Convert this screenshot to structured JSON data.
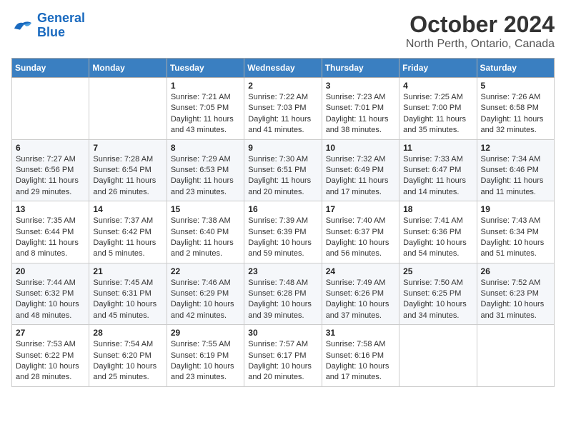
{
  "header": {
    "logo_line1": "General",
    "logo_line2": "Blue",
    "month_year": "October 2024",
    "location": "North Perth, Ontario, Canada"
  },
  "days_of_week": [
    "Sunday",
    "Monday",
    "Tuesday",
    "Wednesday",
    "Thursday",
    "Friday",
    "Saturday"
  ],
  "weeks": [
    [
      {
        "day": "",
        "sunrise": "",
        "sunset": "",
        "daylight": ""
      },
      {
        "day": "",
        "sunrise": "",
        "sunset": "",
        "daylight": ""
      },
      {
        "day": "1",
        "sunrise": "Sunrise: 7:21 AM",
        "sunset": "Sunset: 7:05 PM",
        "daylight": "Daylight: 11 hours and 43 minutes."
      },
      {
        "day": "2",
        "sunrise": "Sunrise: 7:22 AM",
        "sunset": "Sunset: 7:03 PM",
        "daylight": "Daylight: 11 hours and 41 minutes."
      },
      {
        "day": "3",
        "sunrise": "Sunrise: 7:23 AM",
        "sunset": "Sunset: 7:01 PM",
        "daylight": "Daylight: 11 hours and 38 minutes."
      },
      {
        "day": "4",
        "sunrise": "Sunrise: 7:25 AM",
        "sunset": "Sunset: 7:00 PM",
        "daylight": "Daylight: 11 hours and 35 minutes."
      },
      {
        "day": "5",
        "sunrise": "Sunrise: 7:26 AM",
        "sunset": "Sunset: 6:58 PM",
        "daylight": "Daylight: 11 hours and 32 minutes."
      }
    ],
    [
      {
        "day": "6",
        "sunrise": "Sunrise: 7:27 AM",
        "sunset": "Sunset: 6:56 PM",
        "daylight": "Daylight: 11 hours and 29 minutes."
      },
      {
        "day": "7",
        "sunrise": "Sunrise: 7:28 AM",
        "sunset": "Sunset: 6:54 PM",
        "daylight": "Daylight: 11 hours and 26 minutes."
      },
      {
        "day": "8",
        "sunrise": "Sunrise: 7:29 AM",
        "sunset": "Sunset: 6:53 PM",
        "daylight": "Daylight: 11 hours and 23 minutes."
      },
      {
        "day": "9",
        "sunrise": "Sunrise: 7:30 AM",
        "sunset": "Sunset: 6:51 PM",
        "daylight": "Daylight: 11 hours and 20 minutes."
      },
      {
        "day": "10",
        "sunrise": "Sunrise: 7:32 AM",
        "sunset": "Sunset: 6:49 PM",
        "daylight": "Daylight: 11 hours and 17 minutes."
      },
      {
        "day": "11",
        "sunrise": "Sunrise: 7:33 AM",
        "sunset": "Sunset: 6:47 PM",
        "daylight": "Daylight: 11 hours and 14 minutes."
      },
      {
        "day": "12",
        "sunrise": "Sunrise: 7:34 AM",
        "sunset": "Sunset: 6:46 PM",
        "daylight": "Daylight: 11 hours and 11 minutes."
      }
    ],
    [
      {
        "day": "13",
        "sunrise": "Sunrise: 7:35 AM",
        "sunset": "Sunset: 6:44 PM",
        "daylight": "Daylight: 11 hours and 8 minutes."
      },
      {
        "day": "14",
        "sunrise": "Sunrise: 7:37 AM",
        "sunset": "Sunset: 6:42 PM",
        "daylight": "Daylight: 11 hours and 5 minutes."
      },
      {
        "day": "15",
        "sunrise": "Sunrise: 7:38 AM",
        "sunset": "Sunset: 6:40 PM",
        "daylight": "Daylight: 11 hours and 2 minutes."
      },
      {
        "day": "16",
        "sunrise": "Sunrise: 7:39 AM",
        "sunset": "Sunset: 6:39 PM",
        "daylight": "Daylight: 10 hours and 59 minutes."
      },
      {
        "day": "17",
        "sunrise": "Sunrise: 7:40 AM",
        "sunset": "Sunset: 6:37 PM",
        "daylight": "Daylight: 10 hours and 56 minutes."
      },
      {
        "day": "18",
        "sunrise": "Sunrise: 7:41 AM",
        "sunset": "Sunset: 6:36 PM",
        "daylight": "Daylight: 10 hours and 54 minutes."
      },
      {
        "day": "19",
        "sunrise": "Sunrise: 7:43 AM",
        "sunset": "Sunset: 6:34 PM",
        "daylight": "Daylight: 10 hours and 51 minutes."
      }
    ],
    [
      {
        "day": "20",
        "sunrise": "Sunrise: 7:44 AM",
        "sunset": "Sunset: 6:32 PM",
        "daylight": "Daylight: 10 hours and 48 minutes."
      },
      {
        "day": "21",
        "sunrise": "Sunrise: 7:45 AM",
        "sunset": "Sunset: 6:31 PM",
        "daylight": "Daylight: 10 hours and 45 minutes."
      },
      {
        "day": "22",
        "sunrise": "Sunrise: 7:46 AM",
        "sunset": "Sunset: 6:29 PM",
        "daylight": "Daylight: 10 hours and 42 minutes."
      },
      {
        "day": "23",
        "sunrise": "Sunrise: 7:48 AM",
        "sunset": "Sunset: 6:28 PM",
        "daylight": "Daylight: 10 hours and 39 minutes."
      },
      {
        "day": "24",
        "sunrise": "Sunrise: 7:49 AM",
        "sunset": "Sunset: 6:26 PM",
        "daylight": "Daylight: 10 hours and 37 minutes."
      },
      {
        "day": "25",
        "sunrise": "Sunrise: 7:50 AM",
        "sunset": "Sunset: 6:25 PM",
        "daylight": "Daylight: 10 hours and 34 minutes."
      },
      {
        "day": "26",
        "sunrise": "Sunrise: 7:52 AM",
        "sunset": "Sunset: 6:23 PM",
        "daylight": "Daylight: 10 hours and 31 minutes."
      }
    ],
    [
      {
        "day": "27",
        "sunrise": "Sunrise: 7:53 AM",
        "sunset": "Sunset: 6:22 PM",
        "daylight": "Daylight: 10 hours and 28 minutes."
      },
      {
        "day": "28",
        "sunrise": "Sunrise: 7:54 AM",
        "sunset": "Sunset: 6:20 PM",
        "daylight": "Daylight: 10 hours and 25 minutes."
      },
      {
        "day": "29",
        "sunrise": "Sunrise: 7:55 AM",
        "sunset": "Sunset: 6:19 PM",
        "daylight": "Daylight: 10 hours and 23 minutes."
      },
      {
        "day": "30",
        "sunrise": "Sunrise: 7:57 AM",
        "sunset": "Sunset: 6:17 PM",
        "daylight": "Daylight: 10 hours and 20 minutes."
      },
      {
        "day": "31",
        "sunrise": "Sunrise: 7:58 AM",
        "sunset": "Sunset: 6:16 PM",
        "daylight": "Daylight: 10 hours and 17 minutes."
      },
      {
        "day": "",
        "sunrise": "",
        "sunset": "",
        "daylight": ""
      },
      {
        "day": "",
        "sunrise": "",
        "sunset": "",
        "daylight": ""
      }
    ]
  ]
}
